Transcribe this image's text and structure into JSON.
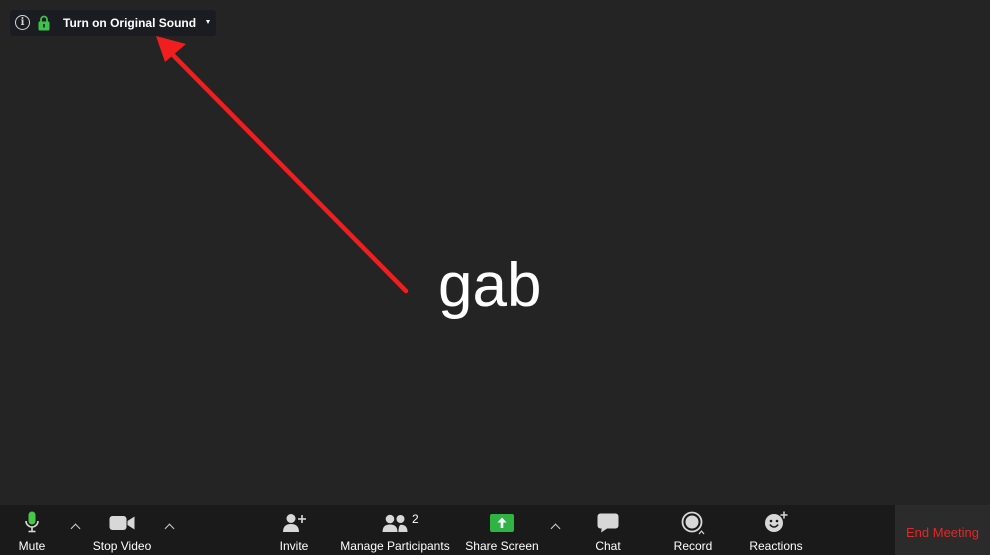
{
  "top_bar": {
    "original_sound_label": "Turn on Original Sound"
  },
  "participant": {
    "name": "gab"
  },
  "toolbar": {
    "mute_label": "Mute",
    "stop_video_label": "Stop Video",
    "invite_label": "Invite",
    "manage_participants_label": "Manage Participants",
    "participant_count": "2",
    "share_screen_label": "Share Screen",
    "chat_label": "Chat",
    "record_label": "Record",
    "reactions_label": "Reactions",
    "end_meeting_label": "End Meeting"
  },
  "colors": {
    "background": "#242424",
    "toolbar": "#1a1a1a",
    "end_meeting_text": "#e02828",
    "share_screen_green": "#2fb344",
    "mic_green": "#45c84a",
    "annotation_arrow": "#f01e1e"
  },
  "icons": {
    "top_bar": [
      "info-icon",
      "lock-icon",
      "caret-down-icon"
    ],
    "toolbar": [
      "microphone-icon",
      "chevron-up-icon",
      "video-camera-icon",
      "add-person-icon",
      "participants-icon",
      "share-screen-icon",
      "chat-bubble-icon",
      "record-icon",
      "reaction-smiley-icon"
    ]
  }
}
